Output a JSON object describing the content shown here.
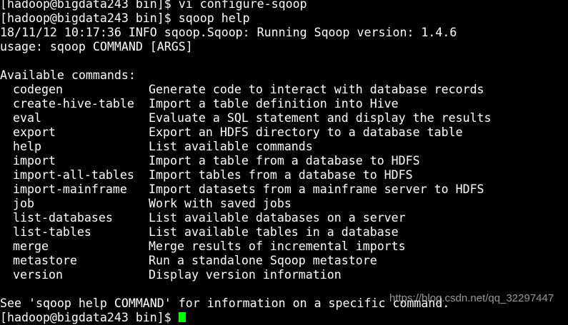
{
  "header_lines": [
    "[hadoop@bigdata243 bin]$ vi configure-sqoop",
    "[hadoop@bigdata243 bin]$ sqoop help",
    "18/11/12 10:17:36 INFO sqoop.Sqoop: Running Sqoop version: 1.4.6",
    "usage: sqoop COMMAND [ARGS]",
    "",
    "Available commands:"
  ],
  "commands": [
    {
      "name": "codegen",
      "desc": "Generate code to interact with database records"
    },
    {
      "name": "create-hive-table",
      "desc": "Import a table definition into Hive"
    },
    {
      "name": "eval",
      "desc": "Evaluate a SQL statement and display the results"
    },
    {
      "name": "export",
      "desc": "Export an HDFS directory to a database table"
    },
    {
      "name": "help",
      "desc": "List available commands"
    },
    {
      "name": "import",
      "desc": "Import a table from a database to HDFS"
    },
    {
      "name": "import-all-tables",
      "desc": "Import tables from a database to HDFS"
    },
    {
      "name": "import-mainframe",
      "desc": "Import datasets from a mainframe server to HDFS"
    },
    {
      "name": "job",
      "desc": "Work with saved jobs"
    },
    {
      "name": "list-databases",
      "desc": "List available databases on a server"
    },
    {
      "name": "list-tables",
      "desc": "List available tables in a database"
    },
    {
      "name": "merge",
      "desc": "Merge results of incremental imports"
    },
    {
      "name": "metastore",
      "desc": "Run a standalone Sqoop metastore"
    },
    {
      "name": "version",
      "desc": "Display version information"
    }
  ],
  "footer_hint": "See 'sqoop help COMMAND' for information on a specific command.",
  "prompt": "[hadoop@bigdata243 bin]$ ",
  "watermark": "https://blog.csdn.net/qq_32297447",
  "colors": {
    "background": "#000000",
    "text": "#ffffff",
    "cursor": "#00ff00"
  }
}
